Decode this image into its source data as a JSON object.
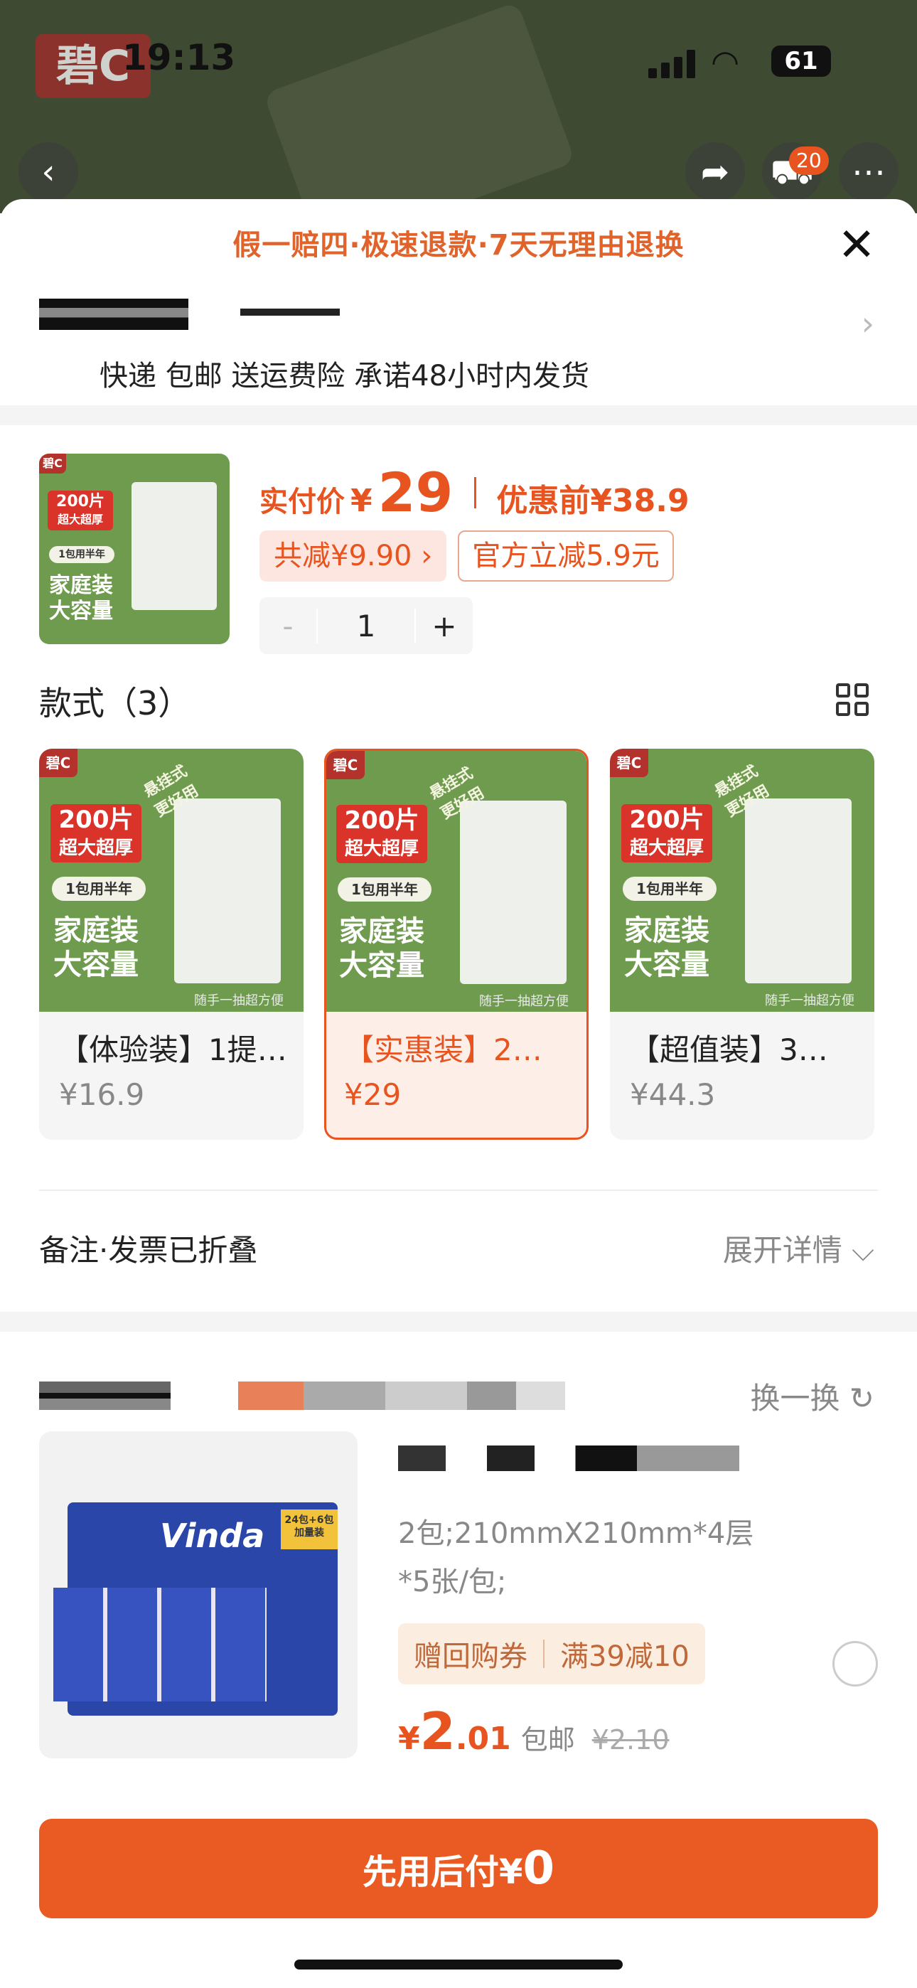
{
  "status": {
    "time": "19:13",
    "battery": "61"
  },
  "top_bar": {
    "badge": "碧C",
    "cart_count": "20"
  },
  "sheet": {
    "guarantee": "假一赔四·极速退款·7天无理由退换",
    "close_icon": "close-icon"
  },
  "address": {
    "shipping": "快递 包邮 送运费险 承诺48小时内发货"
  },
  "product": {
    "paid_label": "实付价",
    "currency": "¥",
    "paid_price": "29",
    "orig_label": "优惠前¥38.9",
    "discount_chip": "共减¥9.90 ›",
    "official_chip": "官方立减5.9元",
    "qty_minus": "-",
    "qty": "1",
    "qty_plus": "+"
  },
  "thumb": {
    "badge": "碧C",
    "slogan": "悬挂式 更好用",
    "tag1": "200片",
    "tag2": "超大超厚",
    "pill": "1包用半年",
    "big1": "家庭装",
    "big2": "大容量",
    "caption": "随手一抽超方便"
  },
  "styles": {
    "title": "款式（3）",
    "items": [
      {
        "name": "【体验装】1提…",
        "price": "¥16.9",
        "selected": false
      },
      {
        "name": "【实惠装】2…",
        "price": "¥29",
        "selected": true
      },
      {
        "name": "【超值装】3…",
        "price": "¥44.3",
        "selected": false
      }
    ]
  },
  "note": {
    "label": "备注·发票已折叠",
    "expand": "展开详情 ⌵"
  },
  "recommend": {
    "swap": "换一换 ↻",
    "spec": "2包;210mmX210mm*4层*5张/包;",
    "tag1": "赠回购券",
    "tag2": "满39减10",
    "price_cur": "¥",
    "price_int": "2",
    "price_dec": ".01",
    "free": "包邮",
    "old": "¥2.10",
    "img_brand": "Vinda",
    "img_label": "24包+6包 加量装"
  },
  "pay": {
    "label": "先用后付¥",
    "amount": "0"
  },
  "colors": {
    "accent": "#e8541f",
    "thumb_green": "#6e9b4e"
  }
}
